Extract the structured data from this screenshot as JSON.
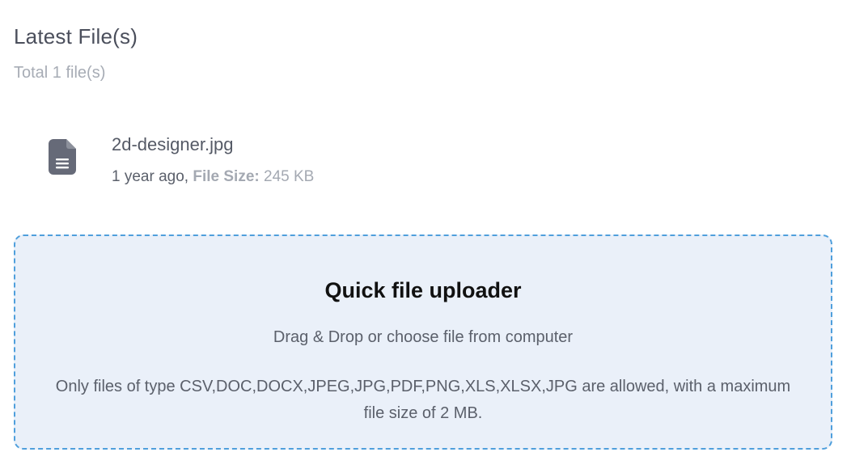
{
  "section": {
    "title": "Latest File(s)",
    "subtitle": "Total 1 file(s)"
  },
  "files": [
    {
      "icon": "document-icon",
      "name": "2d-designer.jpg",
      "age": "1 year ago,",
      "size_label": "File Size:",
      "size_value": "245 KB"
    }
  ],
  "uploader": {
    "title": "Quick file uploader",
    "subtitle": "Drag & Drop or choose file from computer",
    "note": "Only files of type CSV,DOC,DOCX,JPEG,JPG,PDF,PNG,XLS,XLSX,JPG are allowed, with a maximum file size of 2 MB."
  },
  "colors": {
    "dropzone_border": "#4f9fdc",
    "dropzone_background": "#eaf0f9",
    "icon": "#666a78"
  }
}
